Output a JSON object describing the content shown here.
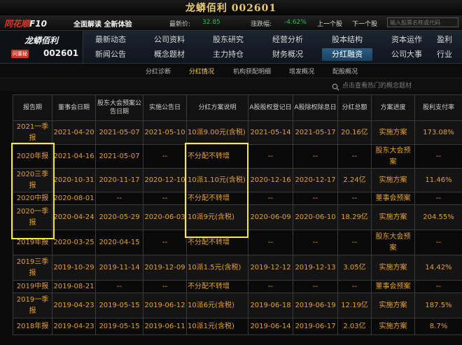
{
  "header": {
    "title": "龙蟒佰利 002601",
    "logo": "同花顺",
    "logo_f10": "F10",
    "tagline": "全面解读 全新体验",
    "price_label": "最新价:",
    "price_value": "32.85",
    "change_label": "涨跌幅:",
    "change_value": "-4.62%",
    "prev_label": "上一个股",
    "next_label": "下一个股",
    "search_placeholder": "输入股票名称或代码"
  },
  "stock": {
    "name": "龙蟒佰利",
    "badge": "问董秘",
    "code": "002601"
  },
  "nav": {
    "row1": [
      "最新动态",
      "公司资料",
      "股东研究",
      "经营分析",
      "股本结构",
      "资本运作",
      "盈利"
    ],
    "row2": [
      "新闻公告",
      "概念题材",
      "主力持仓",
      "财务概况",
      "分红融资",
      "公司大事",
      "行业"
    ]
  },
  "subnav": [
    "分红诊断",
    "分红情况",
    "机构获配明细",
    "增发概况",
    "配股概况"
  ],
  "info_text": "点击查看热门的概念题材",
  "colors": {
    "accent": "#e6a030",
    "highlight": "#f4ec3c",
    "down": "#22c04a"
  },
  "table": {
    "headers": [
      "报告期",
      "董事会日期",
      "股东大会预案公告日期",
      "实施公告日",
      "分红方案说明",
      "A股股权登记日",
      "A股除权除息日",
      "分红总额",
      "方案进度",
      "股利支付率"
    ],
    "rows": [
      [
        "2021一季报",
        "2021-04-20",
        "2021-05-07",
        "2021-05-10",
        "10派9.00元(含税)",
        "2021-05-14",
        "2021-05-17",
        "20.16亿",
        "实施方案",
        "173.08%"
      ],
      [
        "2020年报",
        "2021-04-16",
        "2021-05-07",
        "--",
        "不分配不转增",
        "--",
        "--",
        "--",
        "股东大会预案",
        "--"
      ],
      [
        "2020三季报",
        "2020-10-31",
        "2020-11-17",
        "2020-12-10",
        "10派1.10元(含税)",
        "2020-12-16",
        "2020-12-17",
        "2.24亿",
        "实施方案",
        "11.46%"
      ],
      [
        "2020中报",
        "2020-08-01",
        "--",
        "--",
        "不分配不转增",
        "--",
        "--",
        "--",
        "董事会预案",
        "--"
      ],
      [
        "2020一季报",
        "2020-04-24",
        "2020-05-29",
        "2020-06-03",
        "10派9元(含税)",
        "2020-06-09",
        "2020-06-10",
        "18.29亿",
        "实施方案",
        "204.55%"
      ],
      [
        "2019年报",
        "2020-03-25",
        "2020-04-15",
        "--",
        "不分配不转增",
        "--",
        "--",
        "--",
        "股东大会预案",
        "--"
      ],
      [
        "2019三季报",
        "2019-10-29",
        "2019-11-14",
        "2019-12-09",
        "10派1.5元(含税)",
        "2019-12-12",
        "2019-12-13",
        "3.05亿",
        "实施方案",
        "14.42%"
      ],
      [
        "2019中报",
        "2019-08-21",
        "--",
        "--",
        "不分配不转增",
        "--",
        "--",
        "--",
        "董事会预案",
        "--"
      ],
      [
        "2019一季报",
        "2019-04-23",
        "2019-05-15",
        "2019-06-12",
        "10派6元(含税)",
        "2019-06-18",
        "2019-06-19",
        "12.19亿",
        "实施方案",
        "187.5%"
      ],
      [
        "2018年报",
        "2019-04-23",
        "2019-05-15",
        "2019-06-11",
        "10派1元(含税)",
        "2019-06-14",
        "2019-06-17",
        "2.03亿",
        "实施方案",
        "8.7%"
      ]
    ]
  }
}
